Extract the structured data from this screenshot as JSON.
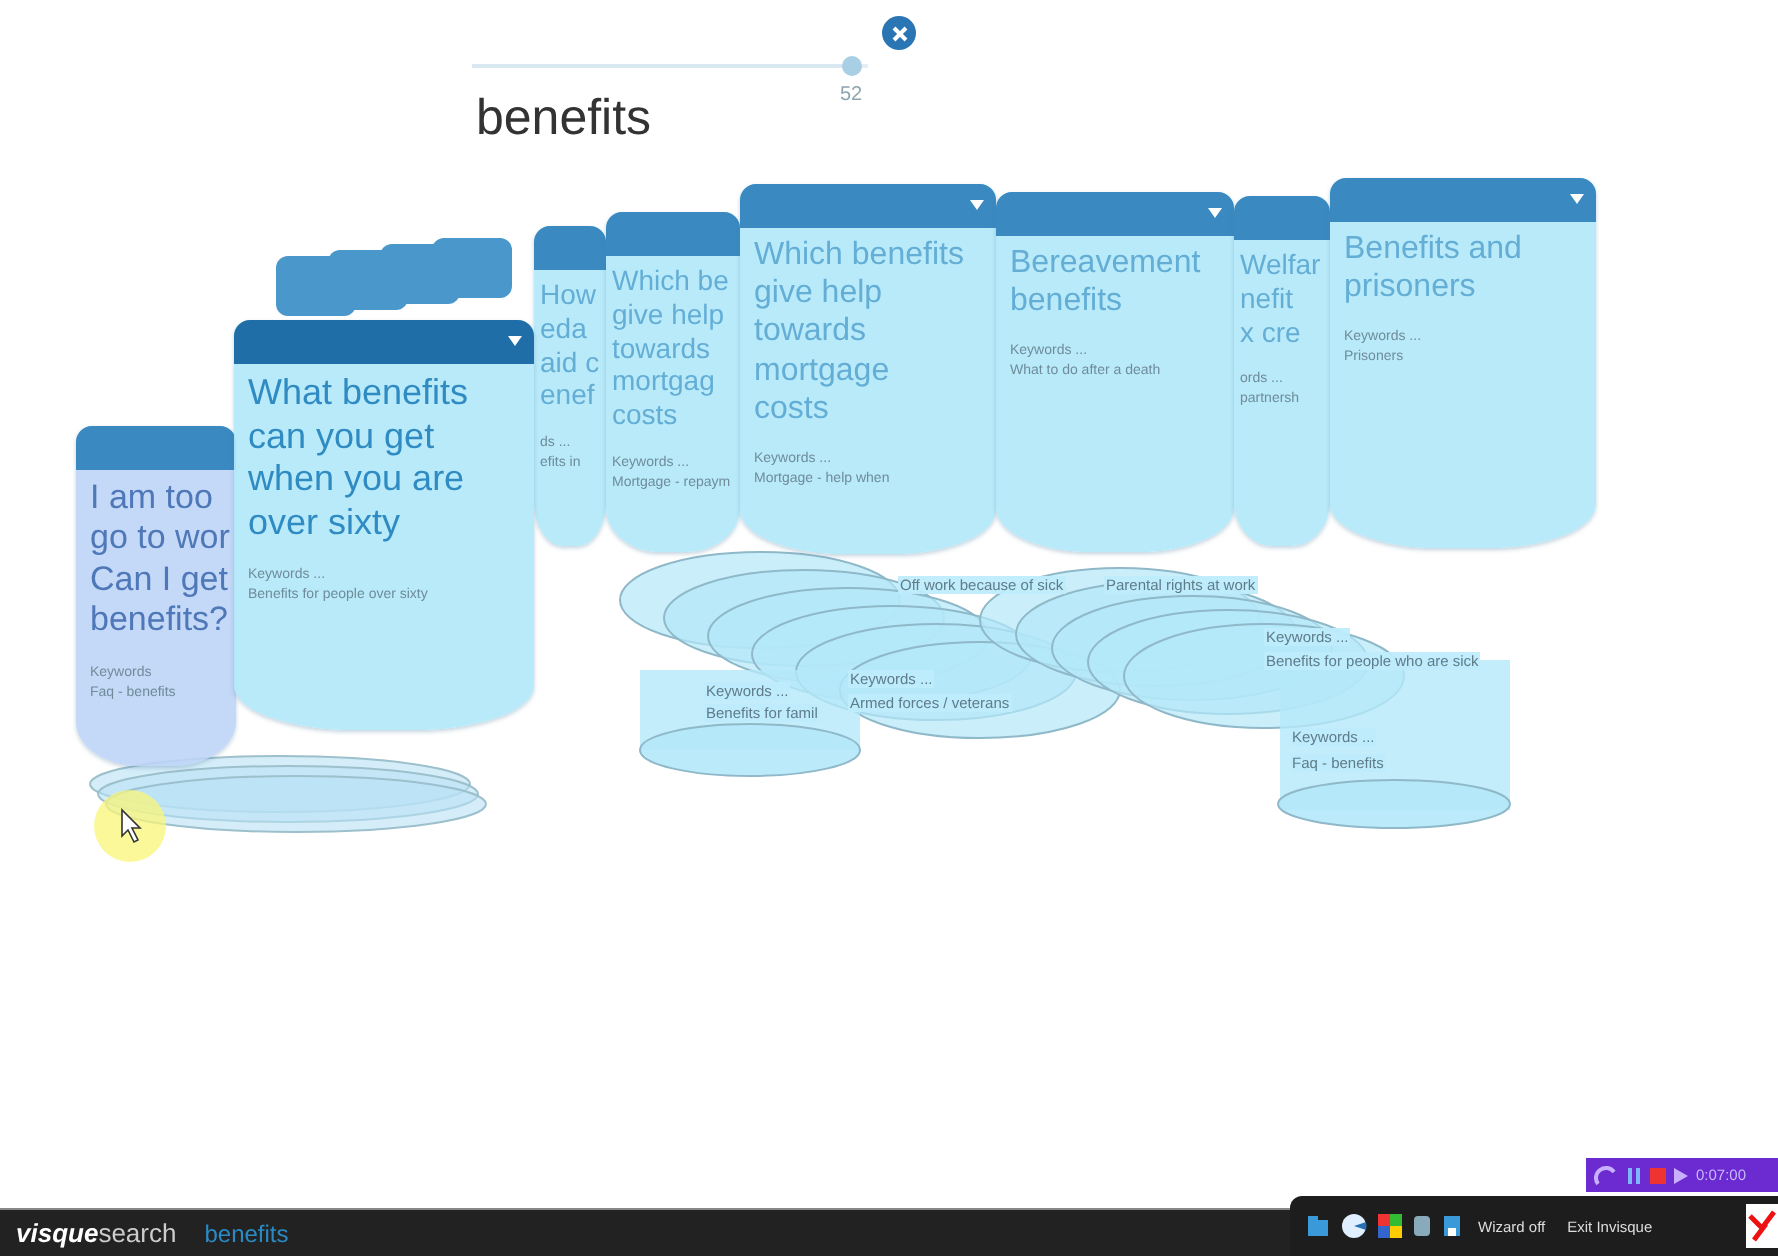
{
  "search": {
    "query": "benefits",
    "slider": {
      "level": 0.96,
      "reading": "52"
    }
  },
  "cards": [
    {
      "title_lines": [
        "I am too",
        "go to wor",
        "Can I get",
        "benefits?"
      ],
      "keywords_label": "Keywords",
      "keywords": "Faq - benefits"
    },
    {
      "title_lines": [
        "What benefits",
        "can you get",
        "when you are",
        "over sixty"
      ],
      "keywords_label": "Keywords ...",
      "keywords": "Benefits for people over sixty"
    },
    {
      "title_lines": [
        "How",
        "eda",
        "aid c",
        "enef"
      ],
      "keywords_label": "ds ...",
      "keywords": "efits in"
    },
    {
      "title_lines": [
        "Which be",
        "give help",
        "towards",
        "mortgag",
        "costs"
      ],
      "keywords_label": "Keywords ...",
      "keywords": "Mortgage - repaym"
    },
    {
      "title_lines": [
        "Which benefits",
        "give help",
        "towards",
        "mortgage",
        "costs"
      ],
      "keywords_label": "Keywords ...",
      "keywords": "Mortgage - help when"
    },
    {
      "title_lines": [
        "Bereavement",
        "benefits"
      ],
      "keywords_label": "Keywords ...",
      "keywords": "What to do after a death"
    },
    {
      "title_lines": [
        "Welfar",
        "nefit",
        "x cre"
      ],
      "keywords_label": "ords ...",
      "keywords": "partnersh"
    },
    {
      "title_lines": [
        "Benefits and",
        "prisoners"
      ],
      "keywords_label": "Keywords ...",
      "keywords": "Prisoners"
    }
  ],
  "stack_labels": [
    {
      "text": "Off work because of sick"
    },
    {
      "text": "Parental rights at work"
    },
    {
      "text": "Keywords ..."
    },
    {
      "text": "Benefits for famil"
    },
    {
      "text": "Keywords ..."
    },
    {
      "text": "Armed forces / veterans"
    },
    {
      "text": "Keywords ..."
    },
    {
      "text": "Benefits for people who are sick"
    },
    {
      "text": "Keywords ..."
    },
    {
      "text": "Faq - benefits"
    }
  ],
  "taskbar": {
    "brand_bold": "visque",
    "brand_rest": "search",
    "query": "benefits",
    "tray_buttons": [
      "Wizard off",
      "Exit Invisque"
    ],
    "recorder": {
      "time": "0:07:00"
    }
  }
}
